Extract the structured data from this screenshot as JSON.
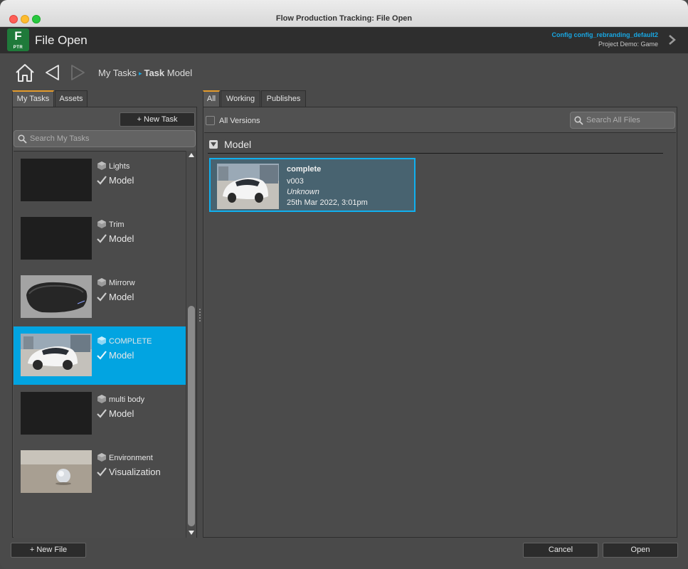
{
  "window": {
    "title": "Flow Production Tracking: File Open"
  },
  "header": {
    "logo_letter": "F",
    "logo_sub": "PTR",
    "title": "File Open",
    "config": "Config config_rebranding_default2",
    "project": "Project Demo: Game"
  },
  "nav": {
    "breadcrumb_root": "My Tasks",
    "breadcrumb_label": "Task",
    "breadcrumb_value": "Model"
  },
  "left": {
    "tabs": [
      {
        "label": "My Tasks"
      },
      {
        "label": "Assets"
      }
    ],
    "new_task_label": "+ New Task",
    "search_placeholder": "Search My Tasks",
    "tasks": [
      {
        "name": "Lights",
        "step": "Model"
      },
      {
        "name": "Trim",
        "step": "Model"
      },
      {
        "name": "Mirrorw",
        "step": "Model"
      },
      {
        "name": "COMPLETE",
        "step": "Model"
      },
      {
        "name": "multi body",
        "step": "Model"
      },
      {
        "name": "Environment",
        "step": "Visualization"
      }
    ]
  },
  "right": {
    "tabs": [
      {
        "label": "All"
      },
      {
        "label": "Working"
      },
      {
        "label": "Publishes"
      }
    ],
    "all_versions_label": "All Versions",
    "search_placeholder": "Search All Files",
    "group": "Model",
    "file": {
      "name": "complete",
      "version": "v003",
      "user": "Unknown",
      "date": "25th Mar 2022, 3:01pm"
    }
  },
  "footer": {
    "new_file_label": "+ New File",
    "cancel_label": "Cancel",
    "open_label": "Open"
  },
  "colors": {
    "accent_blue": "#02a4e1",
    "tab_orange": "#e39b2b",
    "logo_green": "#1f7a3a"
  }
}
